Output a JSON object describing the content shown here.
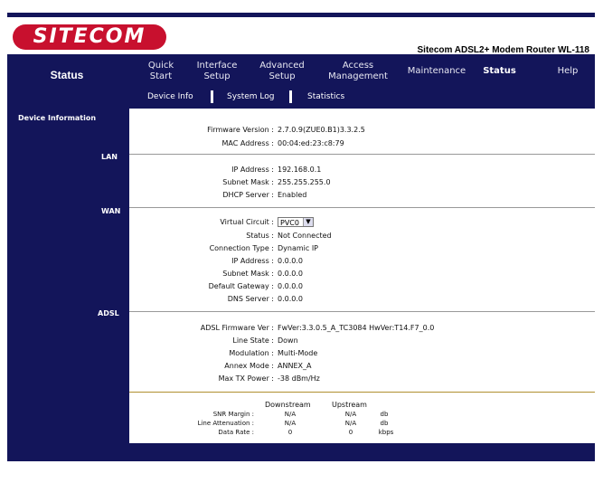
{
  "header": {
    "logo_text": "SITECOM",
    "model": "Sitecom ADSL2+ Modem Router WL-118"
  },
  "section_title": "Status",
  "nav": [
    {
      "label_line1": "Quick",
      "label_line2": "Start"
    },
    {
      "label_line1": "Interface",
      "label_line2": "Setup"
    },
    {
      "label_line1": "Advanced",
      "label_line2": "Setup"
    },
    {
      "label_line1": "Access",
      "label_line2": "Management"
    },
    {
      "label_line1": "Maintenance",
      "label_line2": ""
    },
    {
      "label_line1": "Status",
      "label_line2": ""
    },
    {
      "label_line1": "Help",
      "label_line2": ""
    }
  ],
  "subnav": [
    "Device Info",
    "System Log",
    "Statistics"
  ],
  "sidebar": {
    "device_info": "Device Information",
    "lan": "LAN",
    "wan": "WAN",
    "adsl": "ADSL"
  },
  "device": {
    "firmware_label": "Firmware Version :",
    "firmware_value": "2.7.0.9(ZUE0.B1)3.3.2.5",
    "mac_label": "MAC Address :",
    "mac_value": "00:04:ed:23:c8:79"
  },
  "lan": {
    "ip_label": "IP Address :",
    "ip_value": "192.168.0.1",
    "mask_label": "Subnet Mask :",
    "mask_value": "255.255.255.0",
    "dhcp_label": "DHCP Server :",
    "dhcp_value": "Enabled"
  },
  "wan": {
    "vc_label": "Virtual Circuit :",
    "vc_value": "PVC0",
    "status_label": "Status :",
    "status_value": "Not Connected",
    "conn_label": "Connection Type :",
    "conn_value": "Dynamic IP",
    "ip_label": "IP Address :",
    "ip_value": "0.0.0.0",
    "mask_label": "Subnet Mask :",
    "mask_value": "0.0.0.0",
    "gw_label": "Default Gateway :",
    "gw_value": "0.0.0.0",
    "dns_label": "DNS Server :",
    "dns_value": "0.0.0.0"
  },
  "adsl": {
    "fw_label": "ADSL Firmware Ver :",
    "fw_value": "FwVer:3.3.0.5_A_TC3084 HwVer:T14.F7_0.0",
    "line_label": "Line State :",
    "line_value": "Down",
    "mod_label": "Modulation :",
    "mod_value": "Multi-Mode",
    "annex_label": "Annex Mode :",
    "annex_value": "ANNEX_A",
    "maxtx_label": "Max TX Power :",
    "maxtx_value": "-38 dBm/Hz"
  },
  "stats": {
    "downstream": "Downstream",
    "upstream": "Upstream",
    "rows": [
      {
        "label": "SNR Margin :",
        "down": "N/A",
        "up": "N/A",
        "unit": "db"
      },
      {
        "label": "Line Attenuation :",
        "down": "N/A",
        "up": "N/A",
        "unit": "db"
      },
      {
        "label": "Data Rate :",
        "down": "0",
        "up": "0",
        "unit": "kbps"
      }
    ]
  }
}
